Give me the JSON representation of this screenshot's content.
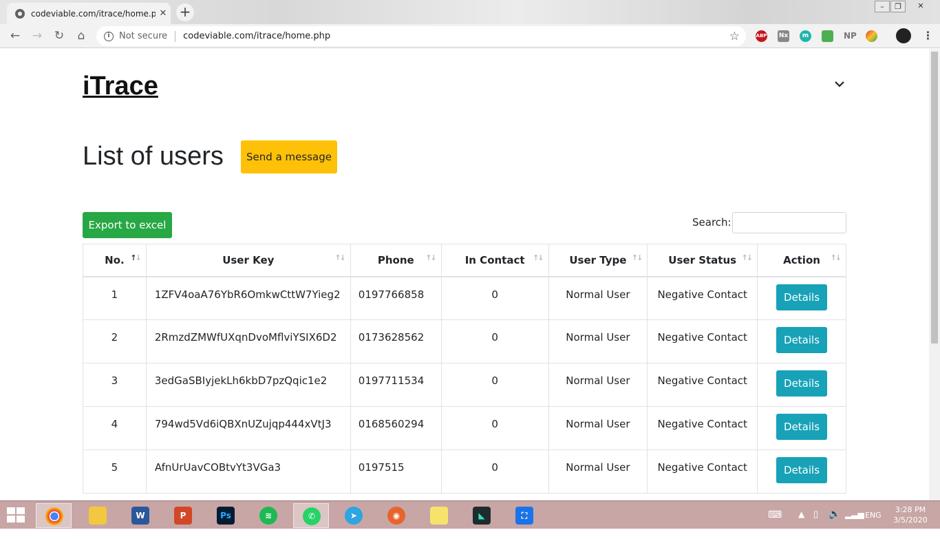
{
  "browser": {
    "tab_title": "codeviable.com/itrace/home.php",
    "security_label": "Not secure",
    "url": "codeviable.com/itrace/home.php",
    "extensions": [
      "ABP",
      "Nx",
      "m",
      "NP"
    ]
  },
  "page": {
    "brand": "iTrace",
    "title": "List of users",
    "send_message_label": "Send a message",
    "export_label": "Export to excel",
    "search_label": "Search:",
    "search_value": ""
  },
  "table": {
    "headers": [
      "No.",
      "User Key",
      "Phone",
      "In Contact",
      "User Type",
      "User Status",
      "Action"
    ],
    "rows": [
      {
        "no": "1",
        "key": "1ZFV4oaA76YbR6OmkwCttW7Yieg2",
        "phone": "0197766858",
        "contact": "0",
        "type": "Normal User",
        "status": "Negative Contact",
        "action": "Details"
      },
      {
        "no": "2",
        "key": "2RmzdZMWfUXqnDvoMflviYSIX6D2",
        "phone": "0173628562",
        "contact": "0",
        "type": "Normal User",
        "status": "Negative Contact",
        "action": "Details"
      },
      {
        "no": "3",
        "key": "3edGaSBIyjekLh6kbD7pzQqic1e2",
        "phone": "0197711534",
        "contact": "0",
        "type": "Normal User",
        "status": "Negative Contact",
        "action": "Details"
      },
      {
        "no": "4",
        "key": "794wd5Vd6iQBXnUZujqp444xVtJ3",
        "phone": "0168560294",
        "contact": "0",
        "type": "Normal User",
        "status": "Negative Contact",
        "action": "Details"
      },
      {
        "no": "5",
        "key": "AfnUrUavCOBtvYt3VGa3",
        "phone": "0197515",
        "contact": "0",
        "type": "Normal User",
        "status": "Negative Contact",
        "action": "Details"
      }
    ]
  },
  "taskbar": {
    "language": "ENG",
    "time": "3:28 PM",
    "date": "3/5/2020"
  },
  "colors": {
    "warning": "#ffc107",
    "success": "#28a745",
    "info": "#17a2b8"
  }
}
